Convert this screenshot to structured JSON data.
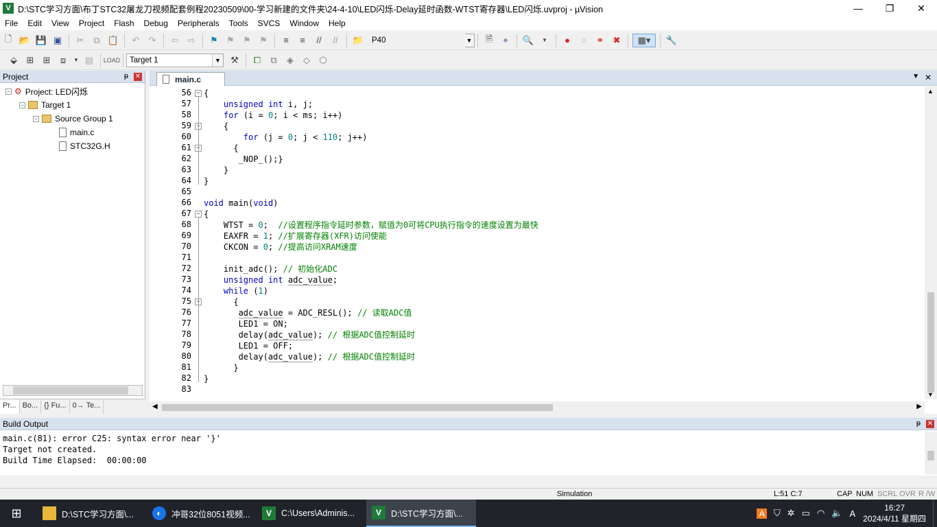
{
  "window": {
    "title": "D:\\STC学习方面\\布丁STC32屠龙刀视频配套例程20230509\\00-学习新建的文件夹\\24-4-10\\LED闪烁-Delay延时函数-WTST寄存器\\LED闪烁.uvproj - µVision",
    "controls": [
      "—",
      "❐",
      "✕"
    ]
  },
  "menu": [
    "File",
    "Edit",
    "View",
    "Project",
    "Flash",
    "Debug",
    "Peripherals",
    "Tools",
    "SVCS",
    "Window",
    "Help"
  ],
  "toolbar": {
    "find_value": "P40",
    "target_value": "Target 1"
  },
  "project_panel": {
    "title": "Project",
    "pin": "ᵽ",
    "close": "✕",
    "root": "Project: LED闪烁",
    "target": "Target 1",
    "group": "Source Group 1",
    "files": [
      "main.c",
      "STC32G.H"
    ],
    "tabs": [
      "Pr...",
      "Bo...",
      "{} Fu...",
      "0→ Te..."
    ]
  },
  "editor": {
    "tab_label": "main.c",
    "lines": [
      {
        "n": "56",
        "t": "{"
      },
      {
        "n": "57",
        "t": "    unsigned int i, j;"
      },
      {
        "n": "58",
        "t": "    for (i = 0; i < ms; i++)"
      },
      {
        "n": "59",
        "t": "    {"
      },
      {
        "n": "60",
        "t": "        for (j = 0; j < 110; j++)"
      },
      {
        "n": "61",
        "t": "      {"
      },
      {
        "n": "62",
        "t": "       _NOP_();}"
      },
      {
        "n": "63",
        "t": "    }"
      },
      {
        "n": "64",
        "t": "}"
      },
      {
        "n": "65",
        "t": ""
      },
      {
        "n": "66",
        "t": "void main(void)"
      },
      {
        "n": "67",
        "t": "{"
      },
      {
        "n": "68",
        "t": "    WTST = 0;  //设置程序指令延时参数，赋值为0可将CPU执行指令的速度设置为最快"
      },
      {
        "n": "69",
        "t": "    EAXFR = 1; //扩展寄存器(XFR)访问使能"
      },
      {
        "n": "70",
        "t": "    CKCON = 0; //提高访问XRAM速度"
      },
      {
        "n": "71",
        "t": ""
      },
      {
        "n": "72",
        "t": "    init_adc(); // 初始化ADC"
      },
      {
        "n": "73",
        "t": "    unsigned int adc_value;"
      },
      {
        "n": "74",
        "t": "    while (1)"
      },
      {
        "n": "75",
        "t": "      {"
      },
      {
        "n": "76",
        "t": "       adc_value = ADC_RESL(); // 读取ADC值"
      },
      {
        "n": "77",
        "t": "       LED1 = ON;"
      },
      {
        "n": "78",
        "t": "       delay(adc_value); // 根据ADC值控制延时"
      },
      {
        "n": "79",
        "t": "       LED1 = OFF;"
      },
      {
        "n": "80",
        "t": "       delay(adc_value); // 根据ADC值控制延时"
      },
      {
        "n": "81",
        "t": "      }"
      },
      {
        "n": "82",
        "t": "}"
      },
      {
        "n": "83",
        "t": ""
      }
    ]
  },
  "build_output": {
    "title": "Build Output",
    "lines": [
      "main.c(81): error C25: syntax error near '}'",
      "Target not created.",
      "Build Time Elapsed:  00:00:00"
    ]
  },
  "status": {
    "mode": "Simulation",
    "position": "L:51 C:7",
    "cap": "CAP",
    "num": "NUM",
    "scrl": "SCRL",
    "ovr": "OVR",
    "rw": "R /W"
  },
  "taskbar": {
    "tasks": [
      {
        "label": "D:\\STC学习方面\\...",
        "icon": "folder-icon"
      },
      {
        "label": "冲哥32位8051视频...",
        "icon": "video-app-icon"
      },
      {
        "label": "C:\\Users\\Adminis...",
        "icon": "uvision-icon"
      },
      {
        "label": "D:\\STC学习方面\\...",
        "icon": "uvision-icon"
      }
    ],
    "time": "16:27",
    "date": "2024/4/11 星期四"
  }
}
